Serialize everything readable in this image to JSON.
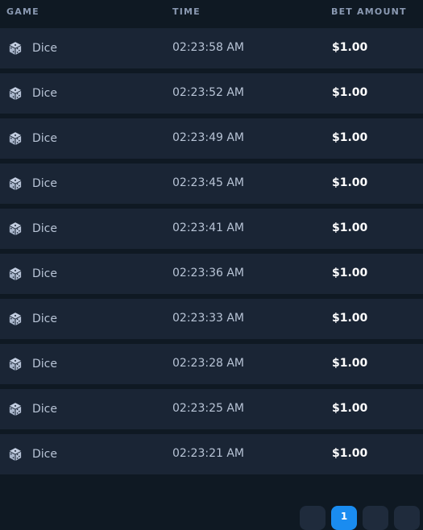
{
  "table": {
    "headers": {
      "game": "GAME",
      "time": "TIME",
      "bet_amount": "BET AMOUNT"
    },
    "rows": [
      {
        "game": "Dice",
        "icon": "dice-icon",
        "time": "02:23:58 AM",
        "bet": "$1.00"
      },
      {
        "game": "Dice",
        "icon": "dice-icon",
        "time": "02:23:52 AM",
        "bet": "$1.00"
      },
      {
        "game": "Dice",
        "icon": "dice-icon",
        "time": "02:23:49 AM",
        "bet": "$1.00"
      },
      {
        "game": "Dice",
        "icon": "dice-icon",
        "time": "02:23:45 AM",
        "bet": "$1.00"
      },
      {
        "game": "Dice",
        "icon": "dice-icon",
        "time": "02:23:41 AM",
        "bet": "$1.00"
      },
      {
        "game": "Dice",
        "icon": "dice-icon",
        "time": "02:23:36 AM",
        "bet": "$1.00"
      },
      {
        "game": "Dice",
        "icon": "dice-icon",
        "time": "02:23:33 AM",
        "bet": "$1.00"
      },
      {
        "game": "Dice",
        "icon": "dice-icon",
        "time": "02:23:28 AM",
        "bet": "$1.00"
      },
      {
        "game": "Dice",
        "icon": "dice-icon",
        "time": "02:23:25 AM",
        "bet": "$1.00"
      },
      {
        "game": "Dice",
        "icon": "dice-icon",
        "time": "02:23:21 AM",
        "bet": "$1.00"
      }
    ]
  },
  "pagination": {
    "pages": [
      "",
      "1",
      "",
      ""
    ],
    "active_index": 1
  },
  "colors": {
    "background": "#0f1923",
    "row_background": "#1a2535",
    "accent": "#1a8cf0"
  }
}
